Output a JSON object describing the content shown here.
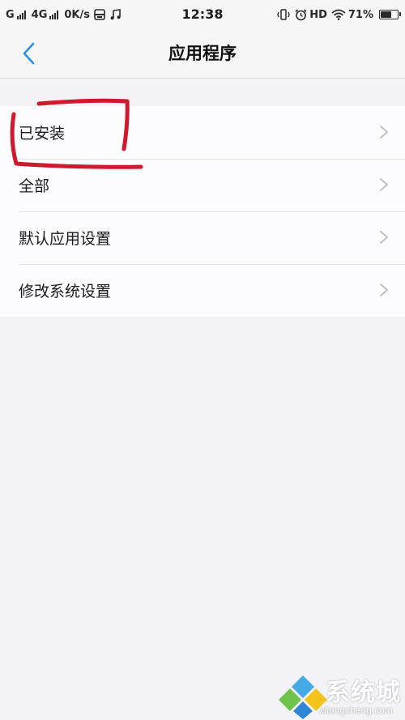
{
  "status_bar": {
    "carrier_1": "G",
    "carrier_2": "4G",
    "net_speed": "0K/s",
    "time": "12:38",
    "hd_label": "HD",
    "battery_percent": "71%",
    "battery_level": 0.71
  },
  "header": {
    "title": "应用程序"
  },
  "settings": {
    "items": [
      {
        "label": "已安装"
      },
      {
        "label": "全部"
      },
      {
        "label": "默认应用设置"
      },
      {
        "label": "修改系统设置"
      }
    ]
  },
  "watermark": {
    "text": "系统城",
    "url": "xitongcheng.com"
  },
  "colors": {
    "accent": "#2a8ff0",
    "annotation": "#d0192e",
    "background": "#f3f2f6",
    "chevron": "#b9b9bd"
  }
}
